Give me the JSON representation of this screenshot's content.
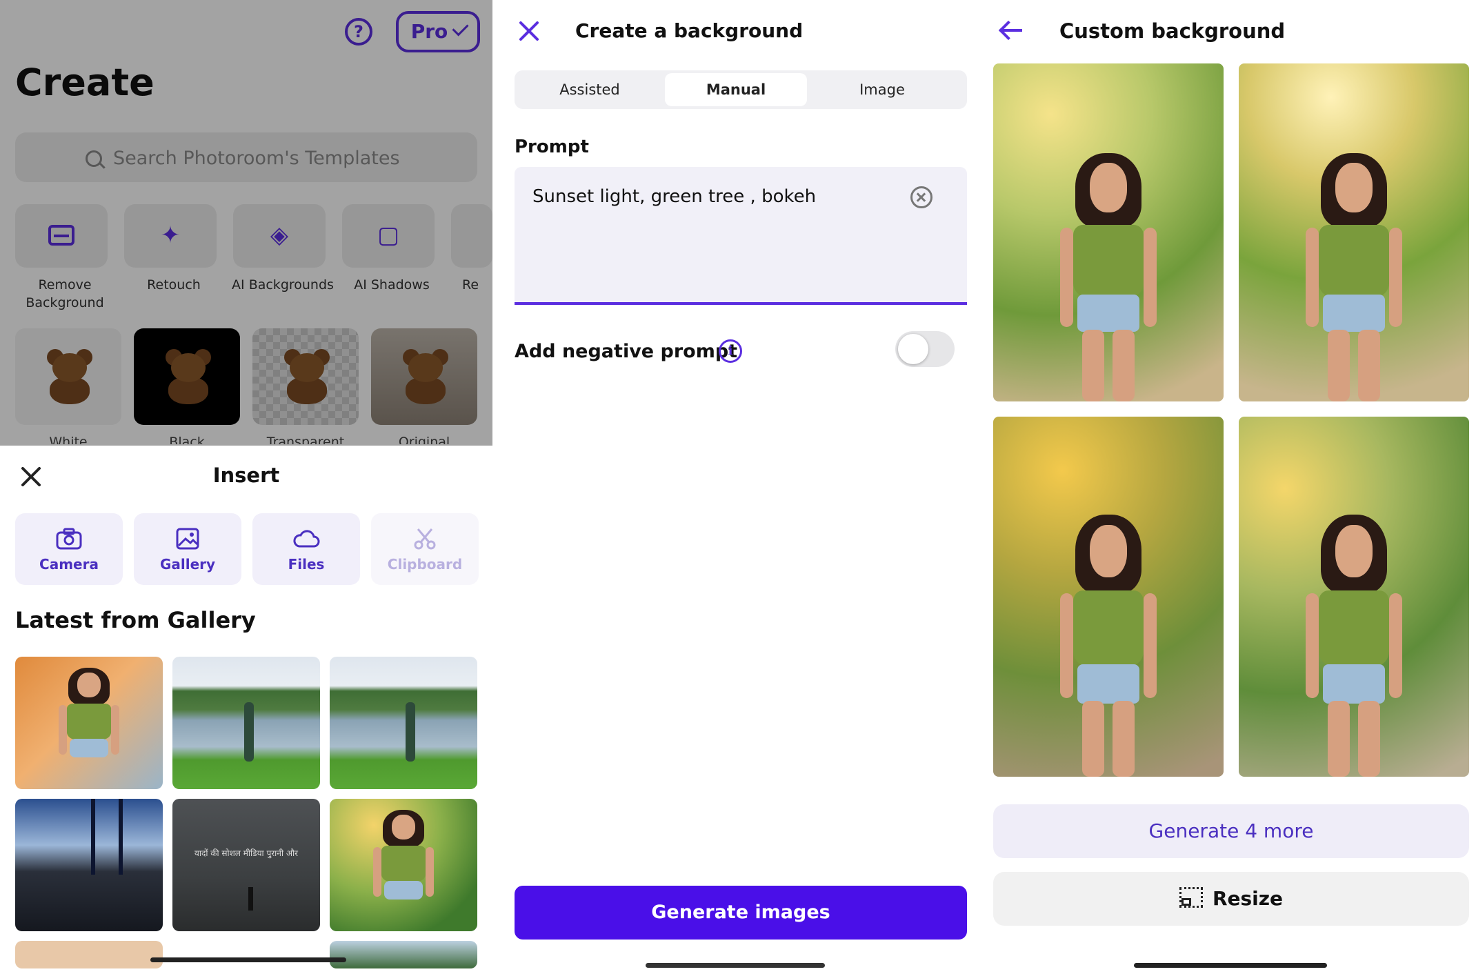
{
  "colors": {
    "accent": "#5b2ee0",
    "primary_button": "#4a0fe8"
  },
  "panel1": {
    "title": "Create",
    "pro_label": "Pro",
    "search_placeholder": "Search Photoroom's Templates",
    "tools": [
      {
        "label": "Remove Background",
        "icon": "remove-background-icon"
      },
      {
        "label": "Retouch",
        "icon": "retouch-eraser-icon"
      },
      {
        "label": "AI Backgrounds",
        "icon": "layers-sparkle-icon"
      },
      {
        "label": "AI Shadows",
        "icon": "shadow-square-icon"
      },
      {
        "label": "Re",
        "icon": "partial-tool-icon"
      }
    ],
    "backgrounds": [
      {
        "label": "White"
      },
      {
        "label": "Black"
      },
      {
        "label": "Transparent"
      },
      {
        "label": "Original"
      }
    ],
    "sheet": {
      "title": "Insert",
      "sources": [
        {
          "label": "Camera",
          "icon": "camera-icon",
          "enabled": true
        },
        {
          "label": "Gallery",
          "icon": "gallery-image-icon",
          "enabled": true
        },
        {
          "label": "Files",
          "icon": "cloud-icon",
          "enabled": true
        },
        {
          "label": "Clipboard",
          "icon": "scissors-icon",
          "enabled": false
        }
      ],
      "gallery_heading": "Latest from Gallery",
      "gallery_caption_hindi": "यादों की सोशल मीडिया पुरानी और"
    }
  },
  "panel2": {
    "title": "Create a background",
    "tabs": [
      {
        "label": "Assisted",
        "selected": false
      },
      {
        "label": "Manual",
        "selected": true
      },
      {
        "label": "Image",
        "selected": false
      }
    ],
    "prompt_label": "Prompt",
    "prompt_value": "Sunset light, green tree , bokeh",
    "negative_prompt_label": "Add negative prompt",
    "negative_prompt_enabled": false,
    "generate_label": "Generate images"
  },
  "panel3": {
    "title": "Custom background",
    "generate_more_label": "Generate 4 more",
    "resize_label": "Resize"
  }
}
